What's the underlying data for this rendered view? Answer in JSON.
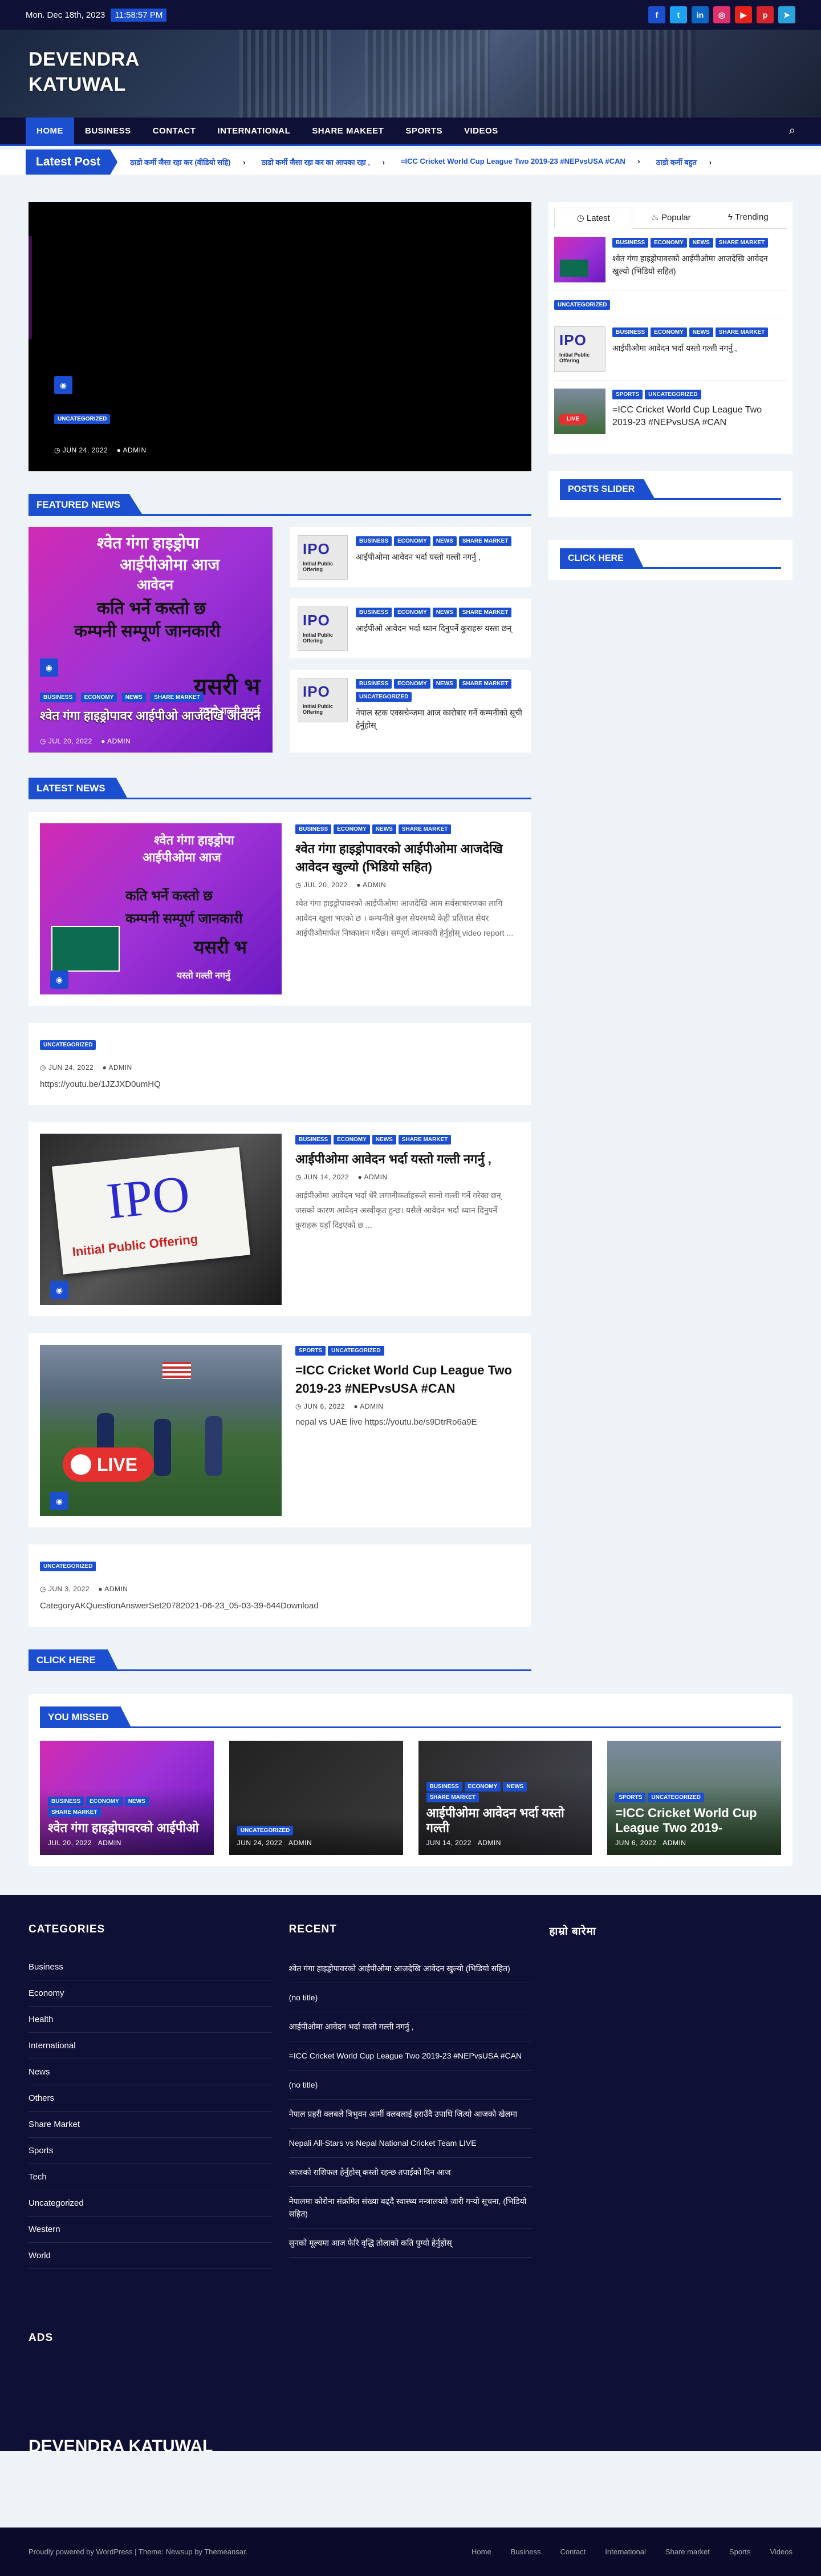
{
  "topbar": {
    "date": "Mon. Dec 18th, 2023",
    "time": "11:58:57 PM"
  },
  "brand": {
    "name_line1": "DEVENDRA",
    "name_line2": "KATUWAL"
  },
  "nav": {
    "items": [
      "HOME",
      "BUSINESS",
      "CONTACT",
      "INTERNATIONAL",
      "SHARE MAKEET",
      "SPORTS",
      "VIDEOS"
    ]
  },
  "ticker": {
    "label": "Latest Post",
    "items": [
      "ठाडो कर्मी जैसा रहा कर (वीडियो सहि)",
      "ठाडो कर्मी जैसा रहा कर का आपका रहा ,",
      "=ICC Cricket World Cup League Two 2019-23 #NEPvsUSA #CAN",
      "ठाडो कर्मी बहुत"
    ]
  },
  "hero": {
    "category": "UNCATEGORIZED",
    "date": "JUN 24, 2022",
    "author": "ADMIN"
  },
  "sections": {
    "featured": "FEATURED NEWS",
    "latest": "LATEST NEWS",
    "click_here": "CLICK HERE",
    "you_missed": "YOU MISSED"
  },
  "featured": {
    "big": {
      "cats": [
        "BUSINESS",
        "ECONOMY",
        "NEWS",
        "SHARE MARKET"
      ],
      "title": "श्वेत गंगा हाइड्रोपावर आईपीओ आजदेखि आवेदन",
      "date": "JUL 20, 2022",
      "author": "ADMIN"
    },
    "art": {
      "l1": "श्वेत गंगा हाइड्रोपा",
      "l2": "आईपीओमा आज",
      "l3": "आवेदन",
      "l4": "कति भर्ने कस्तो छ",
      "l5": "कम्पनी सम्पूर्ण जानकारी",
      "l6": "यसरी भ",
      "l7": "यस्तो गल्ती नगर्नु"
    },
    "list": [
      {
        "cats": [
          "BUSINESS",
          "ECONOMY",
          "NEWS",
          "SHARE MARKET"
        ],
        "title": "आईपीओमा आवेदन भर्दा यस्तो गल्ती नगर्नु ,"
      },
      {
        "cats": [
          "BUSINESS",
          "ECONOMY",
          "NEWS",
          "SHARE MARKET"
        ],
        "title": "आईपीओ आवेदन भर्दा ध्यान दिनुपर्ने कुराहरू यस्ता छन्"
      },
      {
        "cats": [
          "BUSINESS",
          "ECONOMY",
          "NEWS",
          "SHARE MARKET",
          "UNCATEGORIZED"
        ],
        "title": "नेपाल स्टक एक्सचेन्जमा आज कारोबार गर्ने कम्पनीको सूची हेर्नुहोस्"
      }
    ],
    "ipo_text": "IPO",
    "ipo_sub": "Initial Public Offering"
  },
  "latest": [
    {
      "cats": [
        "BUSINESS",
        "ECONOMY",
        "NEWS",
        "SHARE MARKET"
      ],
      "title": "श्वेत गंगा हाइड्रोपावरको आईपीओमा आजदेखि आवेदन खुल्यो (भिडियो सहित)",
      "date": "JUL 20, 2022",
      "author": "ADMIN",
      "excerpt": "श्वेत गंगा हाइड्रोपावरको आईपीओमा आजदेखि आम सर्वसाधारणका लागि आवेदन खुला भएको छ । कम्पनीले कुल सेयरमध्ये केही प्रतिशत सेयर आईपीओमार्फत निष्काशन गर्दैछ। सम्पूर्ण जानकारी हेर्नुहोस् video report ..."
    },
    {
      "cats": [
        "UNCATEGORIZED"
      ],
      "date": "JUN 24, 2022",
      "author": "ADMIN",
      "text": "https://youtu.be/1JZJXD0umHQ"
    },
    {
      "cats": [
        "BUSINESS",
        "ECONOMY",
        "NEWS",
        "SHARE MARKET"
      ],
      "title": "आईपीओमा आवेदन भर्दा यस्तो गल्ती नगर्नु ,",
      "date": "JUN 14, 2022",
      "author": "ADMIN",
      "excerpt": "आईपीओमा आवेदन भर्दा धेरै लगानीकर्ताहरूले सानो गल्ती गर्ने गरेका छन् जसको कारण आवेदन अस्वीकृत हुन्छ। यसैले आवेदन भर्दा ध्यान दिनुपर्ने कुराहरू यहाँ दिइएको छ ..."
    },
    {
      "cats": [
        "SPORTS",
        "UNCATEGORIZED"
      ],
      "title": "=ICC Cricket World Cup League Two 2019-23 #NEPvsUSA #CAN",
      "date": "JUN 6, 2022",
      "author": "ADMIN",
      "excerpt": "nepal vs UAE live https://youtu.be/s9DtrRo6a9E"
    },
    {
      "cats": [
        "UNCATEGORIZED"
      ],
      "date": "JUN 3, 2022",
      "author": "ADMIN",
      "text": "CategoryAKQuestionAnswerSet20782021-06-23_05-03-39-644Download"
    }
  ],
  "sidebar": {
    "tabs": [
      "Latest",
      "Popular",
      "Trending"
    ],
    "items": [
      {
        "cats": [
          "BUSINESS",
          "ECONOMY",
          "NEWS",
          "SHARE MARKET"
        ],
        "title": "श्वेत गंगा हाइड्रोपावरको आईपीओमा आजदेखि आवेदन खुल्यो (भिडियो सहित)"
      },
      {
        "cats": [
          "UNCATEGORIZED"
        ],
        "title": ""
      },
      {
        "cats": [
          "BUSINESS",
          "ECONOMY",
          "NEWS",
          "SHARE MARKET"
        ],
        "title": "आईपीओमा आवेदन भर्दा यस्तो गल्ती नगर्नु ,"
      },
      {
        "cats": [
          "SPORTS",
          "UNCATEGORIZED"
        ],
        "title": "=ICC Cricket World Cup League Two 2019-23 #NEPvsUSA #CAN"
      }
    ],
    "posts_slider": "POSTS SLIDER",
    "click_here": "CLICK HERE",
    "live": "LIVE"
  },
  "missed": [
    {
      "cats": [
        "BUSINESS",
        "ECONOMY",
        "NEWS",
        "SHARE MARKET"
      ],
      "title": "श्वेत गंगा हाइड्रोपावरको आईपीओ",
      "date": "JUL 20, 2022",
      "author": "ADMIN"
    },
    {
      "cats": [
        "UNCATEGORIZED"
      ],
      "title": "",
      "date": "JUN 24, 2022",
      "author": "ADMIN"
    },
    {
      "cats": [
        "BUSINESS",
        "ECONOMY",
        "NEWS",
        "SHARE MARKET"
      ],
      "title": "आईपीओमा आवेदन भर्दा यस्तो गल्ती",
      "date": "JUN 14, 2022",
      "author": "ADMIN"
    },
    {
      "cats": [
        "SPORTS",
        "UNCATEGORIZED"
      ],
      "title": "=ICC Cricket World Cup League Two 2019-",
      "date": "JUN 6, 2022",
      "author": "ADMIN"
    }
  ],
  "footer": {
    "categories_title": "CATEGORIES",
    "categories": [
      "Business",
      "Economy",
      "Health",
      "International",
      "News",
      "Others",
      "Share Market",
      "Sports",
      "Tech",
      "Uncategorized",
      "Western",
      "World"
    ],
    "recent_title": "RECENT",
    "recent": [
      "श्वेत गंगा हाइड्रोपावरको आईपीओमा आजदेखि आवेदन खुल्यो (भिडियो सहित)",
      "(no title)",
      "आईपीओमा आवेदन भर्दा यस्तो गल्ती नगर्नु ,",
      "=ICC Cricket World Cup League Two 2019-23 #NEPvsUSA #CAN",
      "(no title)",
      "नेपाल प्रहरी क्लबले त्रिभुवन आर्मी क्लबलाई हराउँदै उपाधि जित्यो आजको खेलमा",
      "Nepali All-Stars vs Nepal National Cricket Team LIVE",
      "आजको राशिफल हेर्नुहोस् कस्तो रहन्छ तपाईंको दिन आज",
      "नेपालमा कोरोना संक्रमित संख्या बढ्दै स्वास्थ्य मन्त्रालयले जारी गर्‍यो सूचना, (भिडियो सहित)",
      "सुनको मूल्यमा आज फेरि वृद्धि तोलाको कति पुग्यो हेर्नुहोस्"
    ],
    "third_title": "हाम्रो बारेमा",
    "ads_title": "ADS",
    "brand": "DEVENDRA KATUWAL",
    "copyright": "Proudly powered by WordPress | Theme: Newsup by Themeansar.",
    "links": [
      "Home",
      "Business",
      "Contact",
      "International",
      "Share market",
      "Sports",
      "Videos"
    ]
  },
  "colors": {
    "accent": "#1b4fcf",
    "dark": "#0f1035"
  }
}
